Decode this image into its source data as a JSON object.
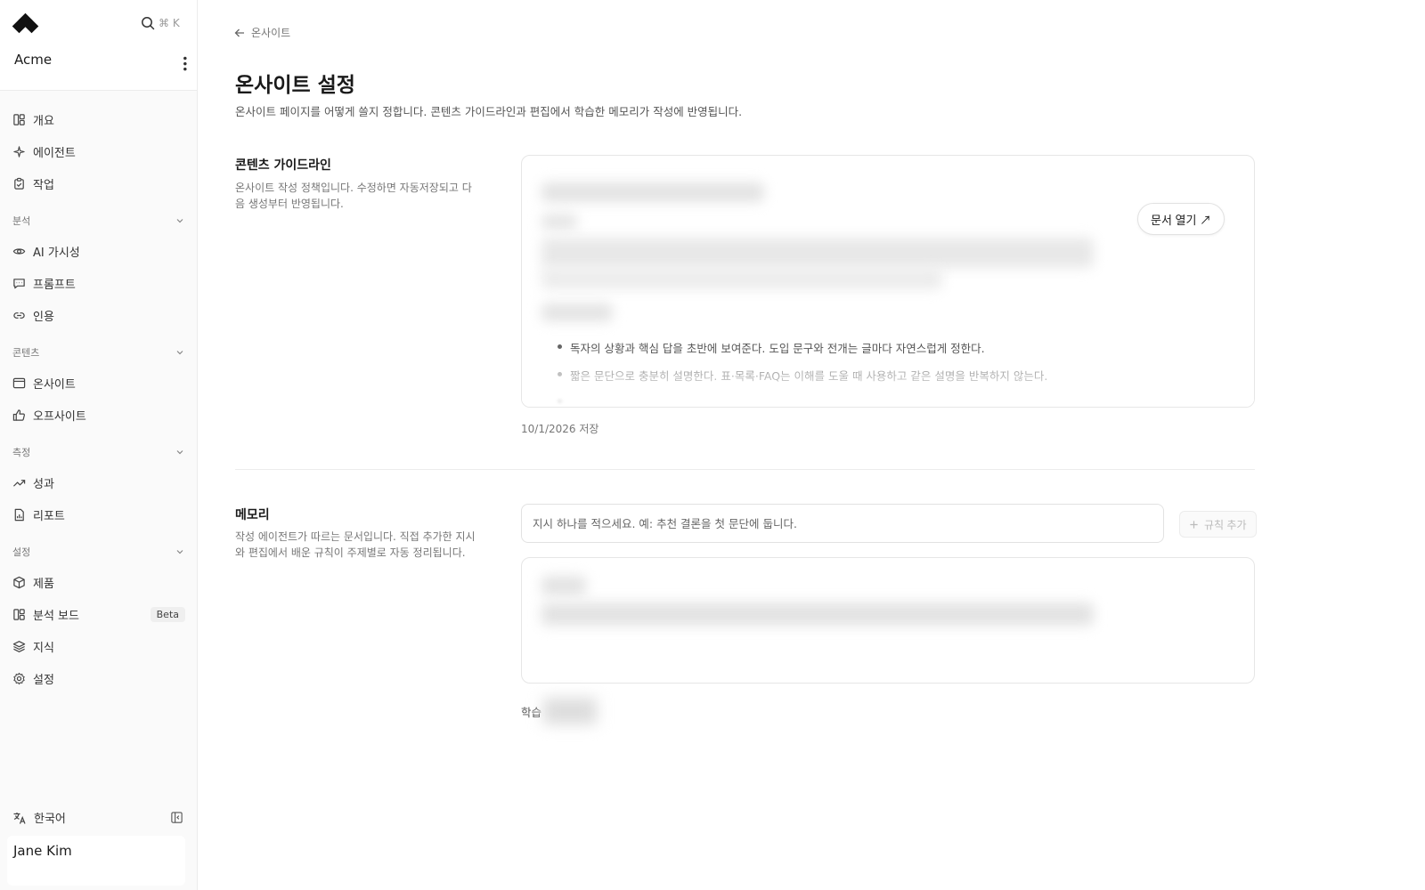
{
  "sidebar": {
    "org_name": "Acme",
    "search_shortcut": "⌘ K",
    "items": {
      "overview": "개요",
      "agents": "에이전트",
      "tasks": "작업"
    },
    "groups": {
      "analysis": {
        "label": "분석",
        "items": {
          "ai_visibility": "AI 가시성",
          "prompts": "프롬프트",
          "citations": "인용"
        }
      },
      "content": {
        "label": "콘텐츠",
        "items": {
          "onsite": "온사이트",
          "offsite": "오프사이트"
        }
      },
      "measure": {
        "label": "측정",
        "items": {
          "performance": "성과",
          "reports": "리포트"
        }
      },
      "settings": {
        "label": "설정",
        "items": {
          "products": "제품",
          "analysis_board": "분석 보드",
          "analysis_board_badge": "Beta",
          "knowledge": "지식",
          "settings": "설정"
        }
      }
    },
    "language": "한국어",
    "user_name": "Jane Kim"
  },
  "main": {
    "breadcrumb": "온사이트",
    "title": "온사이트 설정",
    "description": "온사이트 페이지를 어떻게 쓸지 정합니다. 콘텐츠 가이드라인과 편집에서 학습한 메모리가 작성에 반영됩니다.",
    "guidelines": {
      "title": "콘텐츠 가이드라인",
      "description": "온사이트 작성 정책입니다. 수정하면 자동저장되고 다음 생성부터 반영됩니다.",
      "bullets": [
        "독자의 상황과 핵심 답을 초반에 보여준다. 도입 문구와 전개는 글마다 자연스럽게 정한다.",
        "짧은 문단으로 충분히 설명한다. 표·목록·FAQ는 이해를 도울 때 사용하고 같은 설명을 반복하지 않는다."
      ],
      "open_doc_label": "문서 열기 ↗",
      "saved_text": "10/1/2026 저장"
    },
    "memory": {
      "title": "메모리",
      "description": "작성 에이전트가 따르는 문서입니다. 직접 추가한 지시와 편집에서 배운 규칙이 주제별로 자동 정리됩니다.",
      "input_placeholder": "지시 하나를 적으세요. 예: 추천 결론을 첫 문단에 둡니다.",
      "add_rule_label": "규칙 추가",
      "learn_label": "학습"
    }
  },
  "colors": {
    "accent": "#111111",
    "border": "#e6e6e6",
    "muted": "#777777"
  }
}
